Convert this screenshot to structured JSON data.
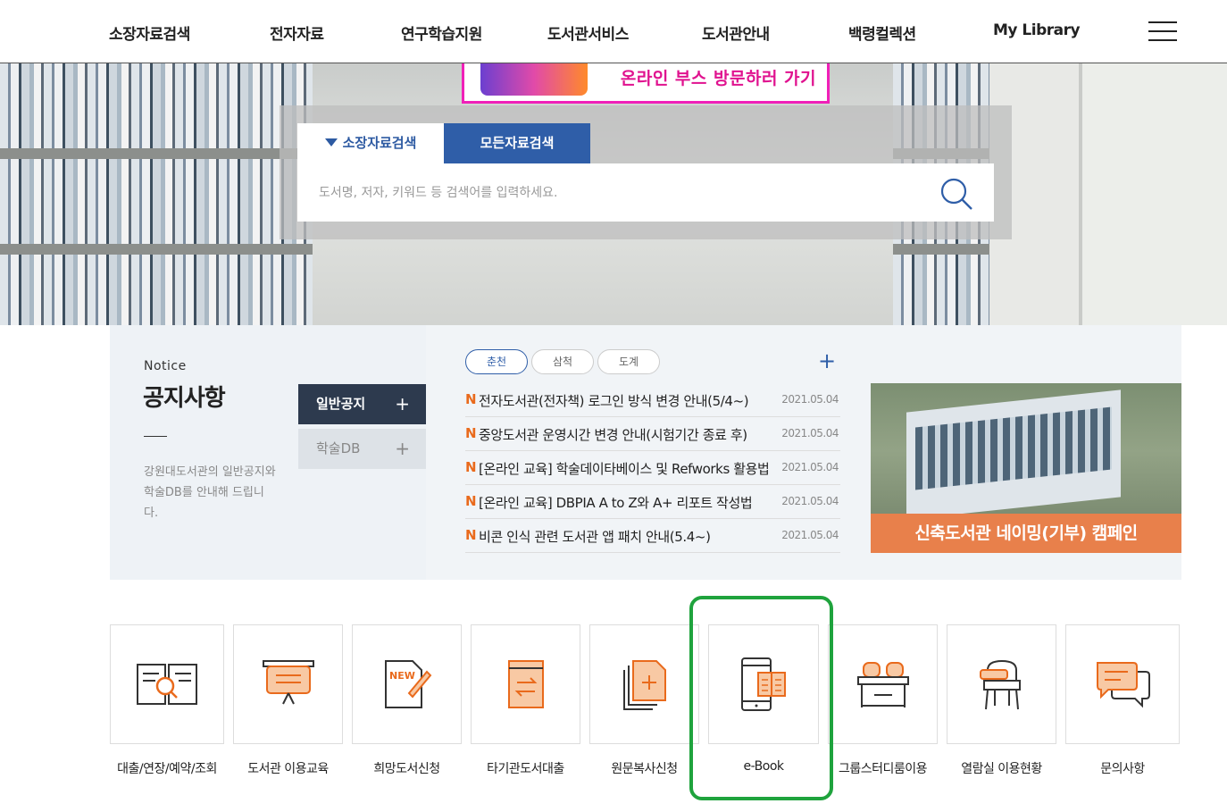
{
  "nav": {
    "items": [
      "소장자료검색",
      "전자자료",
      "연구학습지원",
      "도서관서비스",
      "도서관안내",
      "백령컬렉션",
      "My Library"
    ]
  },
  "banner": {
    "text": "온라인 부스 방문하러 가기"
  },
  "search": {
    "tab_active": "소장자료검색",
    "tab_other": "모든자료검색",
    "placeholder": "도서명, 저자, 키워드 등 검색어를 입력하세요."
  },
  "notice": {
    "label_en": "Notice",
    "title": "공지사항",
    "description": "강원대도서관의 일반공지와 학술DB를 안내해 드립니다.",
    "side_tabs": [
      "일반공지",
      "학술DB"
    ],
    "campus_tabs": [
      "춘천",
      "삼척",
      "도계"
    ],
    "new_marker": "N",
    "items": [
      {
        "title": "전자도서관(전자책) 로그인 방식 변경 안내(5/4~)",
        "date": "2021.05.04"
      },
      {
        "title": "중앙도서관 운영시간 변경 안내(시험기간 종료 후)",
        "date": "2021.05.04"
      },
      {
        "title": "[온라인 교육] 학술데이타베이스 및 Refworks 활용법",
        "date": "2021.05.04"
      },
      {
        "title": "[온라인 교육] DBPIA A to Z와 A+ 리포트 작성법",
        "date": "2021.05.04"
      },
      {
        "title": "비콘 인식 관련 도서관 앱 패치 안내(5.4~)",
        "date": "2021.05.04"
      }
    ]
  },
  "campaign": {
    "text": "신축도서관 네이밍(기부) 캠페인"
  },
  "quick_menu": [
    {
      "label": "대출/연장/예약/조회",
      "icon": "book-search-icon"
    },
    {
      "label": "도서관 이용교육",
      "icon": "presentation-board-icon"
    },
    {
      "label": "희망도서신청",
      "icon": "new-document-icon"
    },
    {
      "label": "타기관도서대출",
      "icon": "book-exchange-icon"
    },
    {
      "label": "원문복사신청",
      "icon": "copy-document-icon"
    },
    {
      "label": "e-Book",
      "icon": "ebook-tablet-icon"
    },
    {
      "label": "그룹스터디룸이용",
      "icon": "study-room-icon"
    },
    {
      "label": "열람실 이용현황",
      "icon": "reading-seat-icon"
    },
    {
      "label": "문의사항",
      "icon": "chat-bubble-icon"
    }
  ],
  "colors": {
    "accent_blue": "#2f5ea8",
    "accent_orange": "#e8804b",
    "highlight_green": "#1fa33d",
    "dark_tab": "#2d3a4e"
  }
}
